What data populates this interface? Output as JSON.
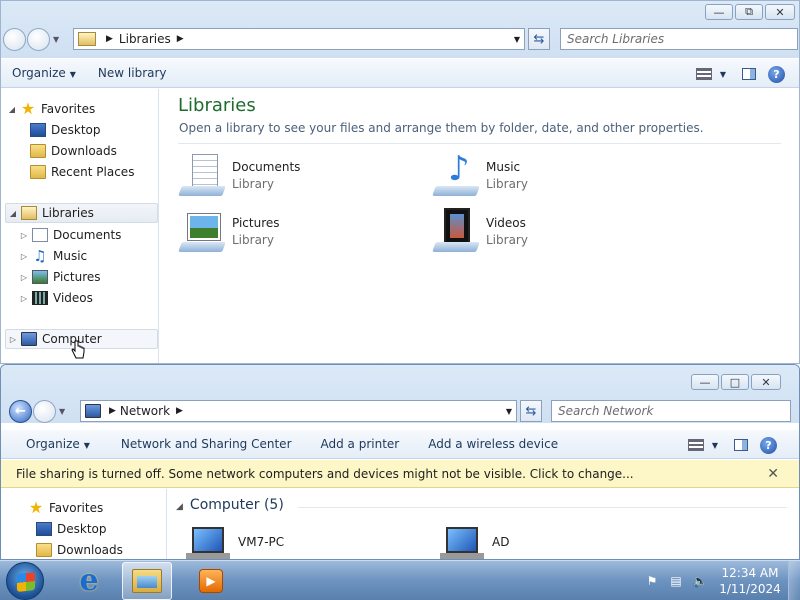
{
  "win1": {
    "address": {
      "crumb": "Libraries"
    },
    "search_placeholder": "Search Libraries",
    "toolbar": {
      "organize": "Organize",
      "new_library": "New library"
    },
    "sidebar": {
      "favorites": "Favorites",
      "fav_items": [
        "Desktop",
        "Downloads",
        "Recent Places"
      ],
      "libraries": "Libraries",
      "lib_items": [
        "Documents",
        "Music",
        "Pictures",
        "Videos"
      ],
      "computer": "Computer"
    },
    "content": {
      "title": "Libraries",
      "subtitle": "Open a library to see your files and arrange them by folder, date, and other properties.",
      "libraries": [
        {
          "name": "Documents",
          "type": "Library"
        },
        {
          "name": "Music",
          "type": "Library"
        },
        {
          "name": "Pictures",
          "type": "Library"
        },
        {
          "name": "Videos",
          "type": "Library"
        }
      ]
    }
  },
  "win2": {
    "address": {
      "crumb": "Network"
    },
    "search_placeholder": "Search Network",
    "toolbar": {
      "organize": "Organize",
      "network_center": "Network and Sharing Center",
      "add_printer": "Add a printer",
      "add_wireless": "Add a wireless device"
    },
    "banner": "File sharing is turned off. Some network computers and devices might not be visible. Click to change...",
    "sidebar": {
      "favorites": "Favorites",
      "fav_items": [
        "Desktop",
        "Downloads"
      ]
    },
    "group": "Computer (5)",
    "computers": [
      "VM7-PC",
      "AD"
    ]
  },
  "taskbar": {
    "time": "12:34 AM",
    "date": "1/11/2024"
  }
}
